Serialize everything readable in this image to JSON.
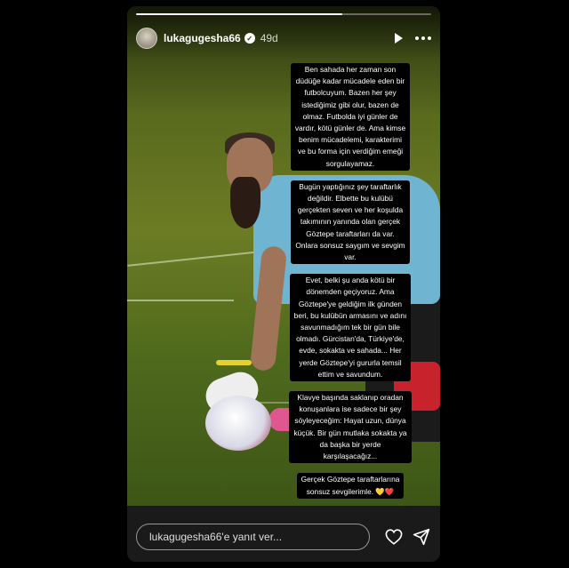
{
  "story": {
    "username": "lukagugesha66",
    "age": "49d",
    "progress": 0.7
  },
  "overlay_text": [
    "Ben sahada her zaman son\ndüdüğe kadar mücadele eden bir\nfutbolcuyum. Bazen her şey\nistediğimiz gibi olur, bazen de\nolmaz. Futbolda iyi günler de\nvardır, kötü günler de. Ama kimse\nbenim mücadelemi, karakterimi\nve bu forma için verdiğim emeği\nsorgulayamaz.",
    "Bugün yaptığınız şey taraftarlık\ndeğildir. Elbette bu kulübü\ngerçekten seven ve her koşulda\ntakımının yanında olan gerçek\nGöztepe taraftarları da var.\nOnlara sonsuz saygım ve sevgim\nvar.",
    "Evet, belki şu anda kötü bir\ndönemden geçiyoruz. Ama\nGöztepe'ye geldiğim ilk günden\nberi, bu kulübün armasını ve adını\nsavunmadığım tek bir gün bile\nolmadı. Gürcistan'da, Türkiye'de,\nevde, sokakta ve sahada... Her\nyerde Göztepe'yi gururla temsil\nettim ve savundum.",
    "Klavye başında saklanıp oradan\nkonuşanlara ise sadece bir şey\nsöyleyeceğim: Hayat uzun, dünya\nküçük. Bir gün mutlaka sokakta ya\nda başka bir yerde\nkarşılaşacağız...",
    "Gerçek Göztepe taraftarlarına\nsonsuz sevgilerimle. 💛❤️"
  ],
  "reply": {
    "placeholder": "lukagugesha66'e yanıt ver..."
  },
  "icons": {
    "header": [
      "play-icon",
      "more-icon"
    ],
    "footer": [
      "heart-icon",
      "send-icon"
    ]
  }
}
